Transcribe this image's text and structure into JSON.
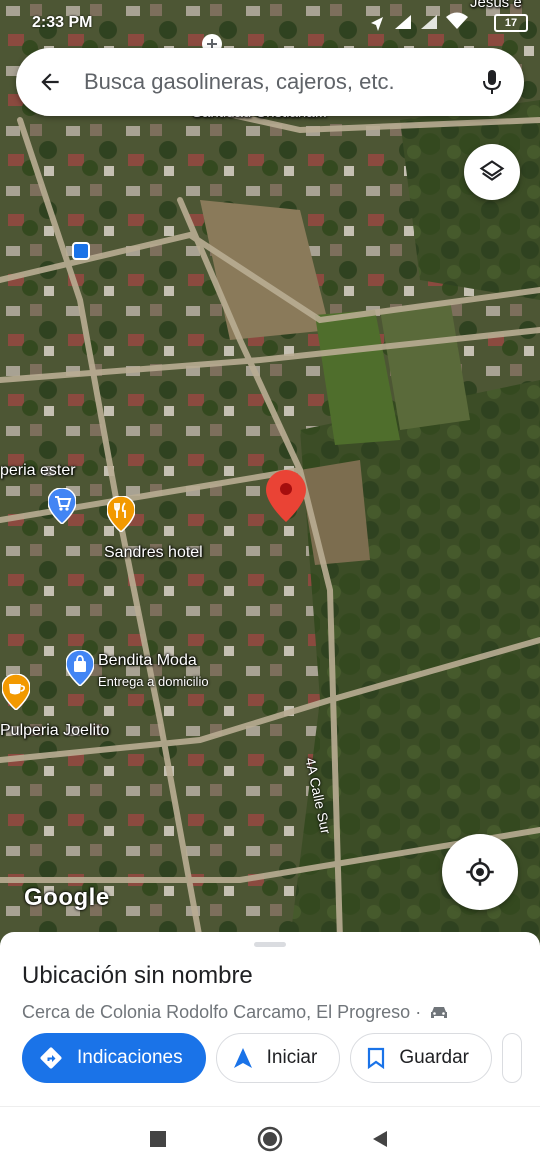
{
  "status_bar": {
    "time": "2:33 PM",
    "battery": "17",
    "icons": [
      "location-icon",
      "signal-icon",
      "signal-icon",
      "wifi-icon",
      "battery-icon"
    ]
  },
  "search": {
    "placeholder": "Busca gasolineras, cajeros, etc.",
    "back_icon": "arrow-back-icon",
    "mic_icon": "mic-icon"
  },
  "map": {
    "place_labels": {
      "top_partial": "Santidad Cristiana...",
      "top_right_partial": "Jesús e",
      "pulperia_ester": "peria ester",
      "sandres_hotel": "Sandres hotel",
      "bendita_moda": "Bendita Moda",
      "bendita_moda_sub": "Entrega a domicilio",
      "pulperia_joelito": "Pulperia Joelito",
      "street": "4A Calle Sur"
    },
    "logo": "Google",
    "colors": {
      "pin_red": "#ea4335",
      "poi_blue": "#4285f4",
      "poi_orange": "#f29900"
    }
  },
  "controls": {
    "layers_icon": "layers-icon",
    "locate_icon": "my-location-icon"
  },
  "sheet": {
    "title": "Ubicación sin nombre",
    "subtitle": "Cerca de Colonia Rodolfo Carcamo, El Progreso ·",
    "actions": {
      "directions": "Indicaciones",
      "start": "Iniciar",
      "save": "Guardar"
    },
    "accent": "#1a73e8"
  },
  "navbar": {
    "icons": [
      "recents-square-icon",
      "home-circle-icon",
      "back-triangle-icon"
    ]
  }
}
